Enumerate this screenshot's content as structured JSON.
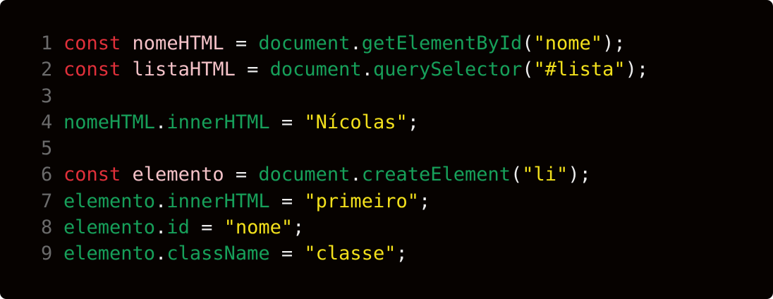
{
  "colors": {
    "background": "#060200",
    "line_number": "#6b6b6b",
    "keyword": "#e0303a",
    "identifier": "#f4c2c8",
    "object_property": "#17a05a",
    "string": "#f2e01c",
    "punctuation": "#ececec"
  },
  "lines": [
    {
      "number": "1",
      "tokens": [
        {
          "type": "keyword",
          "text": "const"
        },
        {
          "type": "punct",
          "text": " "
        },
        {
          "type": "ident",
          "text": "nomeHTML"
        },
        {
          "type": "punct",
          "text": " = "
        },
        {
          "type": "object",
          "text": "document"
        },
        {
          "type": "punct",
          "text": "."
        },
        {
          "type": "prop",
          "text": "getElementById"
        },
        {
          "type": "punct",
          "text": "("
        },
        {
          "type": "string",
          "text": "\"nome\""
        },
        {
          "type": "punct",
          "text": ");"
        }
      ]
    },
    {
      "number": "2",
      "tokens": [
        {
          "type": "keyword",
          "text": "const"
        },
        {
          "type": "punct",
          "text": " "
        },
        {
          "type": "ident",
          "text": "listaHTML"
        },
        {
          "type": "punct",
          "text": " = "
        },
        {
          "type": "object",
          "text": "document"
        },
        {
          "type": "punct",
          "text": "."
        },
        {
          "type": "prop",
          "text": "querySelector"
        },
        {
          "type": "punct",
          "text": "("
        },
        {
          "type": "string",
          "text": "\"#lista\""
        },
        {
          "type": "punct",
          "text": ");"
        }
      ]
    },
    {
      "number": "3",
      "tokens": []
    },
    {
      "number": "4",
      "tokens": [
        {
          "type": "object",
          "text": "nomeHTML"
        },
        {
          "type": "punct",
          "text": "."
        },
        {
          "type": "prop",
          "text": "innerHTML"
        },
        {
          "type": "punct",
          "text": " = "
        },
        {
          "type": "string",
          "text": "\"Nícolas\""
        },
        {
          "type": "punct",
          "text": ";"
        }
      ]
    },
    {
      "number": "5",
      "tokens": []
    },
    {
      "number": "6",
      "tokens": [
        {
          "type": "keyword",
          "text": "const"
        },
        {
          "type": "punct",
          "text": " "
        },
        {
          "type": "ident",
          "text": "elemento"
        },
        {
          "type": "punct",
          "text": " = "
        },
        {
          "type": "object",
          "text": "document"
        },
        {
          "type": "punct",
          "text": "."
        },
        {
          "type": "prop",
          "text": "createElement"
        },
        {
          "type": "punct",
          "text": "("
        },
        {
          "type": "string",
          "text": "\"li\""
        },
        {
          "type": "punct",
          "text": ");"
        }
      ]
    },
    {
      "number": "7",
      "tokens": [
        {
          "type": "object",
          "text": "elemento"
        },
        {
          "type": "punct",
          "text": "."
        },
        {
          "type": "prop",
          "text": "innerHTML"
        },
        {
          "type": "punct",
          "text": " = "
        },
        {
          "type": "string",
          "text": "\"primeiro\""
        },
        {
          "type": "punct",
          "text": ";"
        }
      ]
    },
    {
      "number": "8",
      "tokens": [
        {
          "type": "object",
          "text": "elemento"
        },
        {
          "type": "punct",
          "text": "."
        },
        {
          "type": "prop",
          "text": "id"
        },
        {
          "type": "punct",
          "text": " = "
        },
        {
          "type": "string",
          "text": "\"nome\""
        },
        {
          "type": "punct",
          "text": ";"
        }
      ]
    },
    {
      "number": "9",
      "tokens": [
        {
          "type": "object",
          "text": "elemento"
        },
        {
          "type": "punct",
          "text": "."
        },
        {
          "type": "prop",
          "text": "className"
        },
        {
          "type": "punct",
          "text": " = "
        },
        {
          "type": "string",
          "text": "\"classe\""
        },
        {
          "type": "punct",
          "text": ";"
        }
      ]
    }
  ]
}
